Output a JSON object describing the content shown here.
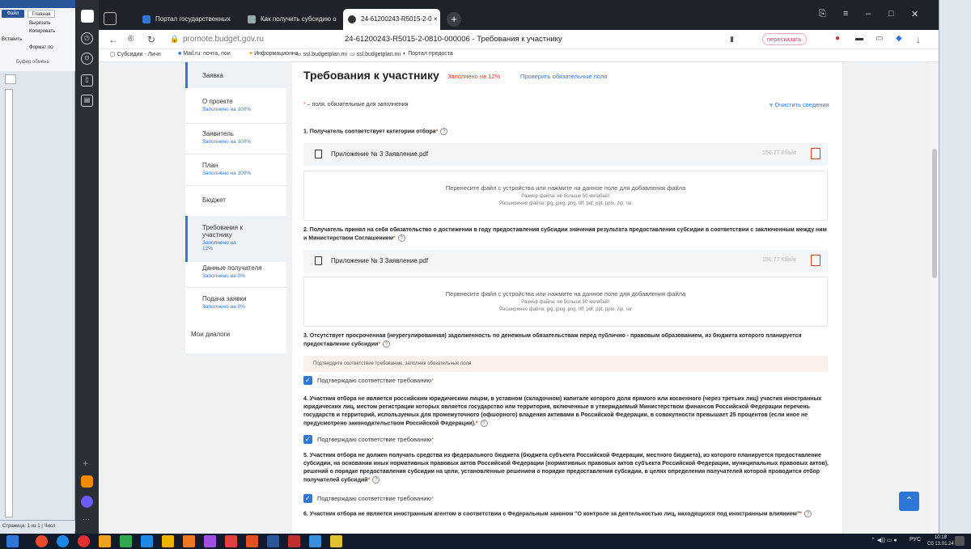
{
  "word": {
    "file_tab": "Файл",
    "home_tab": "Главная",
    "cut": "Вырезать",
    "copy": "Копировать",
    "paste": "Вставить",
    "format": "Формат по",
    "clipboard": "Буфер обмена",
    "status": "Страница: 1 из 1 | Числ"
  },
  "browser": {
    "tabs": [
      {
        "label": "Портал государственных"
      },
      {
        "label": "Как получить субсидию о"
      },
      {
        "label": "24-61200243-R5015-2-0 ×"
      }
    ],
    "url_domain": "promote.budget.gov.ru",
    "page_title": "24-61200243-R5015-2-0810-000006 - Требования к участнику",
    "retell_label": "пересказать",
    "bookmarks": [
      "Субсидии - Личн",
      "Mail.ru: почта, пои",
      "Информационна",
      "ssl.budgetplan.mi",
      "ssl.budgetplan.mi",
      "Портал предоста"
    ]
  },
  "sidebar": {
    "header": "Заявка",
    "items": [
      {
        "label": "О проекте",
        "status": "Заполнено на 100%"
      },
      {
        "label": "Заявитель",
        "status": "Заполнено на 100%"
      },
      {
        "label": "План",
        "status": "Заполнено на 100%"
      },
      {
        "label": "Бюджет",
        "status": ""
      },
      {
        "label": "Требования к участнику",
        "status": "Заполнено на 12%"
      },
      {
        "label": "Данные получателя",
        "status": "Заполнено на 0%"
      },
      {
        "label": "Подача заявки",
        "status": "Заполнено на 0%"
      },
      {
        "label": "Мои диалоги",
        "status": ""
      }
    ]
  },
  "main": {
    "title": "Требования к участнику",
    "fill_status": "Заполнено на 12%",
    "check_link": "Проверить обязательные поля",
    "required_note": " – поля, обязательные для заполнения",
    "clear_link": "Очистить сведения",
    "q1": "1. Получатель соответствует категории отбора",
    "q2": "2. Получатель принял на себя обязательство о достижении в году предоставления субсидии значения результата предоставления субсидии в соответствии с заключенным между ним и Министерством Соглашением",
    "q3": "3. Отсутствует просроченная (неурегулированная) задолженность по денежным обязательствам перед публично - правовым образованием, из бюджета которого планируется предоставление субсидии",
    "q4": "4. Участник отбора не является российским юридическим лицом, в уставном (складочном) капитале которого доля прямого или косвенного (через третьих лиц) участия иностранных юридических лиц, местом регистрации которых является государство или территория, включенные в утверждаемый Министерством финансов Российской Федерации перечень государств и территорий, используемых для промежуточного (офшорного) владения активами в Российской Федерации, в совокупности превышает 25 процентов (если иное не предусмотрено законодательством Российской Федерации).",
    "q5": "5. Участник отбора не должен получать средства из федерального бюджета (бюджета субъекта Российской Федерации, местного бюджета), из которого планируется предоставление субсидии, на основании иных нормативных правовых актов Российской Федерации (нормативных правовых актов субъекта Российской Федерации, муниципальных правовых актов), решений о порядке предоставления субсидии на цели, установленные решением о порядке предоставления субсидии, в целях определения получателей которой проводится отбор получателей субсидий",
    "q6": "6. Участник отбора не является иностранным агентом в соответствии с Федеральным законом \"О контроле за деятельностью лиц, находящихся под иностранным влиянием\"",
    "file_name": "Приложение № 3 Заявление.pdf",
    "file_size": "150.77 Кбайт",
    "drop_text": "Перенесите файл с устройства или нажмите на данное поле для добавления файла",
    "drop_size": "Размер файла: не больше 50 мегабайт",
    "drop_ext": "Расширение файла: jpg, jpeg, png, tiff, pdf, ppt, pptx, zip, rar",
    "warn_text": "Подтвердите соответствие требованию, заполнив обязательные поля",
    "confirm_label": "Подтверждаю соответствие требованию"
  },
  "taskbar": {
    "lang": "РУС",
    "time": "10:18",
    "date": "Сб 13.01.24"
  },
  "colors": {
    "accent": "#2f76d9",
    "warning": "#d23c23",
    "required": "#e25c1f"
  }
}
